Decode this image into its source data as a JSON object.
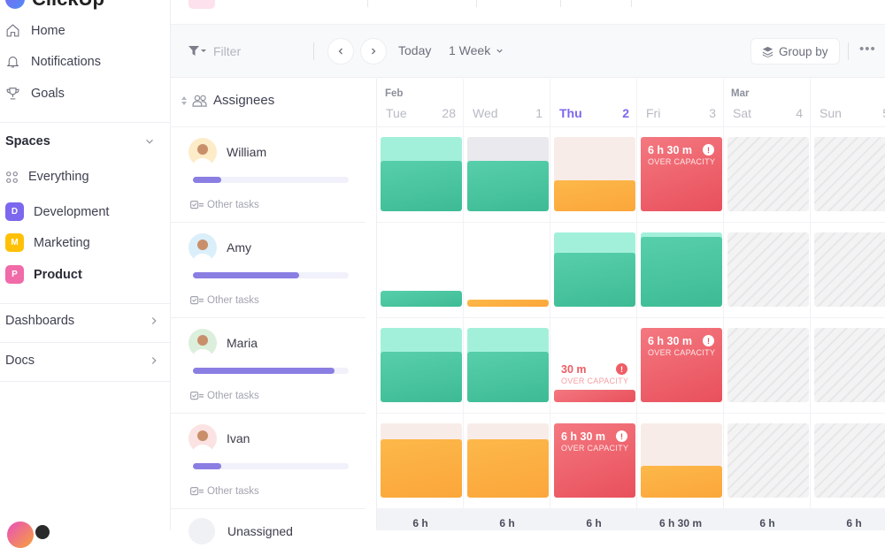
{
  "app": {
    "name": "ClickUp"
  },
  "sidebar": {
    "nav": [
      {
        "label": "Home",
        "icon": "home-icon"
      },
      {
        "label": "Notifications",
        "icon": "bell-icon"
      },
      {
        "label": "Goals",
        "icon": "trophy-icon"
      }
    ],
    "spaces_label": "Spaces",
    "everything_label": "Everything",
    "spaces": [
      {
        "letter": "D",
        "label": "Development",
        "color": "#7b68ee"
      },
      {
        "letter": "M",
        "label": "Marketing",
        "color": "#ffc107"
      },
      {
        "letter": "P",
        "label": "Product",
        "color": "#f06ba8"
      }
    ],
    "dashboards_label": "Dashboards",
    "docs_label": "Docs"
  },
  "toolbar": {
    "filter_placeholder": "Filter",
    "today_label": "Today",
    "range_label": "1 Week",
    "groupby_label": "Group by",
    "more_label": "•••"
  },
  "assignees": {
    "header": "Assignees",
    "other_tasks_label": "Other tasks",
    "people": [
      {
        "name": "William",
        "workload": 0.18,
        "avatar_bg": "#fdecc8"
      },
      {
        "name": "Amy",
        "workload": 0.68,
        "avatar_bg": "#dbeffa"
      },
      {
        "name": "Maria",
        "workload": 0.91,
        "avatar_bg": "#dcefdc"
      },
      {
        "name": "Ivan",
        "workload": 0.18,
        "avatar_bg": "#fbe3e3"
      }
    ],
    "unassigned_label": "Unassigned"
  },
  "calendar": {
    "months": [
      {
        "label": "Feb"
      },
      {
        "label": "Mar"
      }
    ],
    "days": [
      {
        "dow": "Tue",
        "date": "28",
        "today": false
      },
      {
        "dow": "Wed",
        "date": "1",
        "today": false
      },
      {
        "dow": "Thu",
        "date": "2",
        "today": true
      },
      {
        "dow": "Fri",
        "date": "3",
        "today": false
      },
      {
        "dow": "Sat",
        "date": "4",
        "today": false
      },
      {
        "dow": "Sun",
        "date": "5",
        "today": false
      }
    ],
    "over_capacity_label": "OVER CAPACITY",
    "rows": [
      [
        {
          "type": "green",
          "fill": 0.68,
          "cap": "green"
        },
        {
          "type": "green",
          "fill": 0.68,
          "cap": "grey"
        },
        {
          "type": "orange",
          "fill": 0.42,
          "cap": "cream"
        },
        {
          "type": "over",
          "text": "6 h 30 m"
        },
        {
          "type": "weekend"
        },
        {
          "type": "weekend"
        }
      ],
      [
        {
          "type": "green",
          "fill": 0.22,
          "cap": "none"
        },
        {
          "type": "orange",
          "fill": 0.09,
          "cap": "none"
        },
        {
          "type": "green",
          "fill": 0.73,
          "cap": "green"
        },
        {
          "type": "green",
          "fill": 0.94,
          "cap": "green"
        },
        {
          "type": "weekend"
        },
        {
          "type": "weekend"
        }
      ],
      [
        {
          "type": "green",
          "fill": 0.68,
          "cap": "green"
        },
        {
          "type": "green",
          "fill": 0.68,
          "cap": "green"
        },
        {
          "type": "over-small",
          "text": "30 m"
        },
        {
          "type": "over",
          "text": "6 h 30 m"
        },
        {
          "type": "weekend"
        },
        {
          "type": "weekend"
        }
      ],
      [
        {
          "type": "orange",
          "fill": 0.78,
          "cap": "cream"
        },
        {
          "type": "orange",
          "fill": 0.78,
          "cap": "cream"
        },
        {
          "type": "over",
          "text": "6 h 30 m"
        },
        {
          "type": "orange",
          "fill": 0.43,
          "cap": "cream"
        },
        {
          "type": "weekend"
        },
        {
          "type": "weekend"
        }
      ]
    ],
    "totals": [
      "6 h",
      "6 h",
      "6 h",
      "6 h 30 m",
      "6 h",
      "6 h"
    ]
  },
  "colors": {
    "accent": "#7b68ee",
    "green": "#4fc9a4",
    "green_light": "#a3f0da",
    "orange": "#fdb13d",
    "cream": "#f8ece8",
    "grey_cap": "#e9e9ee",
    "red": "#ef5d66"
  }
}
